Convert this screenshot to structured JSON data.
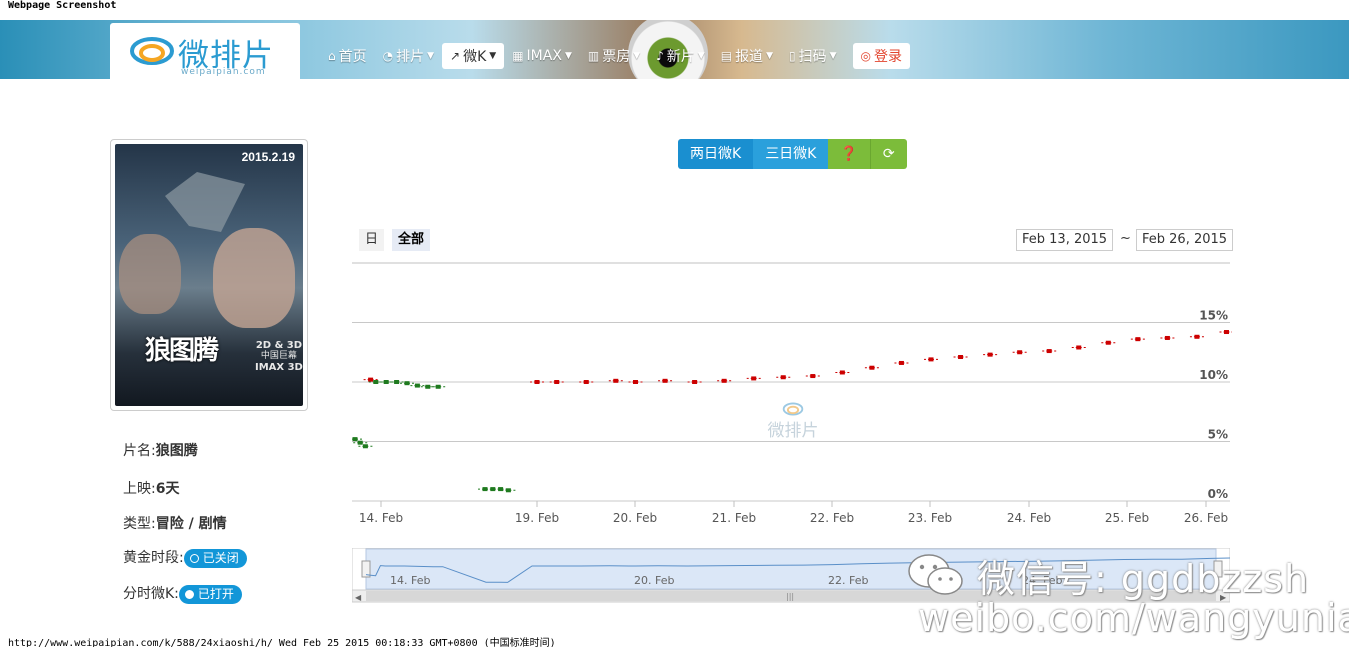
{
  "caption": {
    "top": "Webpage Screenshot",
    "bottom": "http://www.weipaipian.com/k/588/24xiaoshi/h/ Wed Feb 25 2015 00:18:33 GMT+0800 (中国标准时间)"
  },
  "logo": {
    "text": "微排片",
    "sub": "weipaipian.com"
  },
  "nav": {
    "items": [
      {
        "label": "首页",
        "icon": "home-icon",
        "caret": false
      },
      {
        "label": "排片",
        "icon": "pie-chart-icon",
        "caret": true
      },
      {
        "label": "微K",
        "icon": "line-chart-icon",
        "caret": true,
        "active": true
      },
      {
        "label": "IMAX",
        "icon": "film-icon",
        "caret": true
      },
      {
        "label": "票房",
        "icon": "bar-chart-icon",
        "caret": true
      },
      {
        "label": "新片",
        "icon": "bell-icon",
        "caret": true
      },
      {
        "label": "报道",
        "icon": "newspaper-icon",
        "caret": true
      },
      {
        "label": "扫码",
        "icon": "phone-icon",
        "caret": true
      }
    ],
    "login": "登录"
  },
  "poster": {
    "date": "2015.2.19",
    "title": "狼图腾",
    "format_line1": "2D & 3D",
    "format_line2": "中国巨幕",
    "format_line3": "IMAX 3D"
  },
  "movie": {
    "name_label": "片名:",
    "name": "狼图腾",
    "release_label": "上映:",
    "release": "6天",
    "type_label": "类型:",
    "type": "冒险 / 剧情",
    "golden_label": "黄金时段:",
    "golden_toggle": "已关闭",
    "split_label": "分时微K:",
    "split_toggle": "已打开"
  },
  "buttons": {
    "two_day": "两日微K",
    "three_day": "三日微K",
    "help_icon": "question-icon",
    "refresh_icon": "refresh-icon"
  },
  "range": {
    "day": "日",
    "all": "全部",
    "from": "Feb 13, 2015",
    "tilde": "~",
    "to": "Feb 26, 2015"
  },
  "watermark": "微排片",
  "social": {
    "wechat": "微信号: ggdbzzsh",
    "weibo": "weibo.com/wangyunian"
  },
  "colors": {
    "up": "#cc0000",
    "down": "#1f7a1f",
    "accent": "#1a8fd0",
    "green": "#7cbc3a"
  },
  "chart_data": {
    "type": "line",
    "title": "",
    "xlabel": "",
    "ylabel": "",
    "ylim": [
      0,
      18
    ],
    "y_ticks": [
      "0%",
      "5%",
      "10%",
      "15%"
    ],
    "y_tick_values": [
      0,
      5,
      10,
      15
    ],
    "x_ticks": [
      "14. Feb",
      "19. Feb",
      "20. Feb",
      "21. Feb",
      "22. Feb",
      "23. Feb",
      "24. Feb",
      "25. Feb",
      "26. Feb"
    ],
    "segments": [
      {
        "direction": "down",
        "points": [
          [
            13.0,
            5.2
          ],
          [
            13.2,
            4.9
          ],
          [
            13.4,
            4.6
          ]
        ]
      },
      {
        "direction": "up",
        "points": [
          [
            13.6,
            10.2
          ]
        ]
      },
      {
        "direction": "down",
        "points": [
          [
            13.8,
            10.0
          ],
          [
            14.2,
            10.0
          ],
          [
            14.6,
            10.0
          ],
          [
            15.0,
            9.9
          ],
          [
            15.4,
            9.7
          ],
          [
            15.8,
            9.6
          ],
          [
            16.2,
            9.6
          ]
        ]
      },
      {
        "direction": "down",
        "points": [
          [
            18.0,
            1.0
          ],
          [
            18.3,
            1.0
          ],
          [
            18.6,
            1.0
          ],
          [
            18.9,
            0.9
          ]
        ]
      },
      {
        "direction": "up",
        "points": [
          [
            19.0,
            10.0
          ],
          [
            19.2,
            10.0
          ],
          [
            19.5,
            10.0
          ],
          [
            19.8,
            10.1
          ],
          [
            20.0,
            10.0
          ],
          [
            20.3,
            10.1
          ],
          [
            20.6,
            10.0
          ]
        ]
      },
      {
        "direction": "up",
        "points": [
          [
            20.9,
            10.1
          ],
          [
            21.2,
            10.3
          ],
          [
            21.5,
            10.4
          ],
          [
            21.8,
            10.5
          ],
          [
            22.1,
            10.8
          ],
          [
            22.4,
            11.2
          ],
          [
            22.7,
            11.6
          ],
          [
            23.0,
            11.9
          ],
          [
            23.3,
            12.1
          ],
          [
            23.6,
            12.3
          ],
          [
            23.9,
            12.5
          ],
          [
            24.2,
            12.6
          ],
          [
            24.5,
            12.9
          ],
          [
            24.8,
            13.3
          ],
          [
            25.1,
            13.6
          ],
          [
            25.4,
            13.7
          ],
          [
            25.7,
            13.8
          ],
          [
            26.0,
            14.2
          ],
          [
            26.3,
            14.6
          ],
          [
            26.6,
            14.9
          ],
          [
            26.9,
            15.1
          ],
          [
            27.2,
            15.1
          ],
          [
            27.5,
            15.2
          ],
          [
            27.8,
            15.5
          ],
          [
            28.0,
            15.6
          ]
        ]
      }
    ]
  }
}
